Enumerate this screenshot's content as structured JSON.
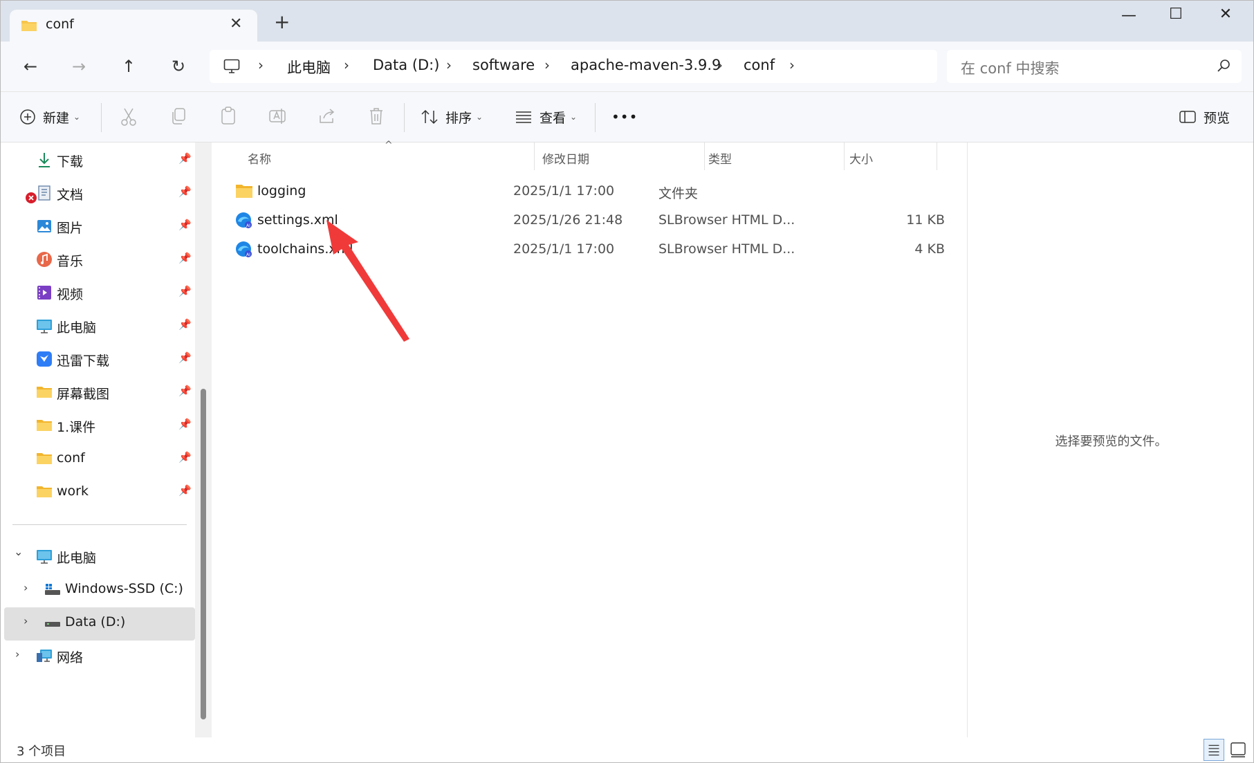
{
  "window": {
    "tab_title": "conf",
    "tab_close": "✕",
    "new_tab": "+",
    "minimize": "—",
    "maximize": "☐",
    "close": "✕"
  },
  "nav": {
    "back": "←",
    "forward": "→",
    "up": "↑",
    "refresh": "↻"
  },
  "breadcrumb": [
    "此电脑",
    "Data (D:)",
    "software",
    "apache-maven-3.9.9",
    "conf"
  ],
  "search": {
    "placeholder": "在 conf 中搜索"
  },
  "toolbar": {
    "new_label": "新建",
    "sort_label": "排序",
    "view_label": "查看",
    "more_label": "•••",
    "preview_label": "预览"
  },
  "sidebar": {
    "quick_access": [
      {
        "label": "下载",
        "icon": "download-icon"
      },
      {
        "label": "文档",
        "icon": "document-icon"
      },
      {
        "label": "图片",
        "icon": "pictures-icon"
      },
      {
        "label": "音乐",
        "icon": "music-icon"
      },
      {
        "label": "视频",
        "icon": "video-icon"
      },
      {
        "label": "此电脑",
        "icon": "computer-icon"
      },
      {
        "label": "迅雷下载",
        "icon": "thunder-icon"
      },
      {
        "label": "屏幕截图",
        "icon": "folder-icon"
      },
      {
        "label": "1.课件",
        "icon": "folder-icon"
      },
      {
        "label": "conf",
        "icon": "folder-icon"
      },
      {
        "label": "work",
        "icon": "folder-icon"
      }
    ],
    "tree": [
      {
        "label": "此电脑",
        "icon": "computer-icon",
        "expander": "⌄"
      },
      {
        "label": "Windows-SSD (C:)",
        "icon": "drive-icon",
        "expander": "›"
      },
      {
        "label": "Data (D:)",
        "icon": "drive-icon",
        "expander": "›"
      },
      {
        "label": "网络",
        "icon": "network-icon",
        "expander": "›"
      }
    ],
    "pin_glyph": "📌"
  },
  "columns": {
    "name": "名称",
    "date": "修改日期",
    "type": "类型",
    "size": "大小",
    "sort_glyph": "^"
  },
  "files": [
    {
      "name": "logging",
      "date": "2025/1/1 17:00",
      "type": "文件夹",
      "size": "",
      "icon": "folder-icon"
    },
    {
      "name": "settings.xml",
      "date": "2025/1/26 21:48",
      "type": "SLBrowser HTML D...",
      "size": "11 KB",
      "icon": "slbrowser-icon"
    },
    {
      "name": "toolchains.xml",
      "date": "2025/1/1 17:00",
      "type": "SLBrowser HTML D...",
      "size": "4 KB",
      "icon": "slbrowser-icon"
    }
  ],
  "preview": {
    "text": "选择要预览的文件。"
  },
  "status": {
    "count": "3 个项目"
  },
  "colors": {
    "annotation_arrow": "#f03a3a",
    "folder": "#f7c64d",
    "accent": "#0067c0"
  }
}
